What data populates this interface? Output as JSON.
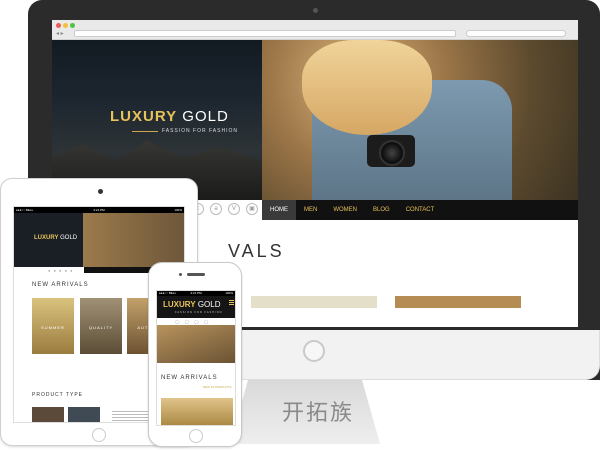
{
  "watermark": "开拓族",
  "desktop": {
    "brand_gold": "LUXURY",
    "brand_rest": " GOLD",
    "tagline": "FASSION FOR FASHION",
    "nav": [
      {
        "label": "HOME",
        "active": true
      },
      {
        "label": "MEN"
      },
      {
        "label": "WOMEN"
      },
      {
        "label": "BLOG"
      },
      {
        "label": "CONTACT"
      }
    ],
    "section_heading_visible": "VALS",
    "social_icons": [
      "t",
      "ə",
      "V",
      "▣"
    ]
  },
  "tablet": {
    "status_left": "●●●○○ BELL",
    "status_center": "4:21 PM",
    "status_right": "100%",
    "brand_gold": "LUXURY",
    "brand_rest": " GOLD",
    "slider_dots": "● ● ● ● ●",
    "new_arrivals": "NEW ARRIVALS",
    "cards": [
      "SUMMER",
      "QUALITY",
      "AUTUM"
    ],
    "product_type": "PRODUCT TYPE"
  },
  "phone": {
    "status_left": "●●●○○ BELL",
    "status_center": "4:21 PM",
    "status_right": "100%",
    "brand_gold": "LUXURY",
    "brand_rest": " GOLD",
    "tagline": "FASSION FOR FASHION",
    "icons": "◯ ◯ ◯ ◯",
    "new_arrivals": "NEW ARRIVALS",
    "products_link": "NEW IN PRODUCTS"
  },
  "colors": {
    "accent_gold": "#e8c25a",
    "dark": "#111111"
  }
}
